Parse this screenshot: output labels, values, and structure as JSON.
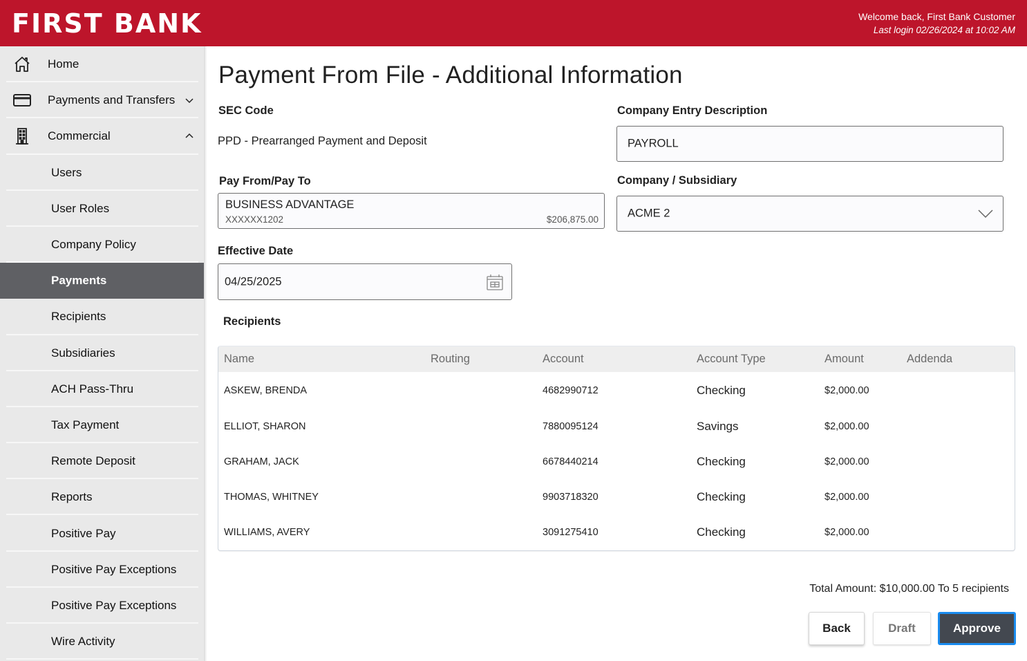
{
  "header": {
    "logo": "FIRST BANK",
    "welcome": "Welcome back, First Bank Customer",
    "last_login": "Last login 02/26/2024 at 10:02 AM",
    "brand_color": "#bd152b"
  },
  "sidebar": {
    "top_items": [
      {
        "label": "Home",
        "icon": "home-icon"
      },
      {
        "label": "Payments and Transfers",
        "icon": "card-icon",
        "chevron": "chevron-down-icon"
      },
      {
        "label": "Commercial",
        "icon": "building-icon",
        "chevron": "chevron-up-icon"
      }
    ],
    "sub_items": [
      {
        "label": "Users"
      },
      {
        "label": "User Roles"
      },
      {
        "label": "Company Policy"
      },
      {
        "label": "Payments",
        "active": true
      },
      {
        "label": "Recipients"
      },
      {
        "label": "Subsidiaries"
      },
      {
        "label": "ACH Pass-Thru"
      },
      {
        "label": "Tax Payment"
      },
      {
        "label": "Remote Deposit"
      },
      {
        "label": "Reports"
      },
      {
        "label": "Positive Pay"
      },
      {
        "label": "Positive Pay Exceptions"
      },
      {
        "label": "Positive Pay Exceptions"
      },
      {
        "label": "Wire Activity"
      }
    ],
    "active_color": "#5f6064"
  },
  "main": {
    "title": "Payment From File - Additional Information",
    "sec_code": {
      "label": "SEC Code",
      "value": "PPD - Prearranged Payment and Deposit"
    },
    "company_entry": {
      "label": "Company Entry Description",
      "value": "PAYROLL"
    },
    "pay_from": {
      "label": "Pay From/Pay To",
      "account_name": "BUSINESS ADVANTAGE",
      "account_number": "XXXXXX1202",
      "balance": "$206,875.00"
    },
    "company_subsidiary": {
      "label": "Company / Subsidiary",
      "selected": "ACME 2"
    },
    "effective_date": {
      "label": "Effective Date",
      "value": "04/25/2025"
    },
    "recipients": {
      "label": "Recipients",
      "columns": [
        "Name",
        "Routing",
        "Account",
        "Account Type",
        "Amount",
        "Addenda"
      ],
      "rows": [
        {
          "name": "ASKEW, BRENDA",
          "routing": "",
          "account": "4682990712",
          "type": "Checking",
          "amount": "$2,000.00",
          "addenda": ""
        },
        {
          "name": "ELLIOT, SHARON",
          "routing": "",
          "account": "7880095124",
          "type": "Savings",
          "amount": "$2,000.00",
          "addenda": ""
        },
        {
          "name": "GRAHAM, JACK",
          "routing": "",
          "account": "6678440214",
          "type": "Checking",
          "amount": "$2,000.00",
          "addenda": ""
        },
        {
          "name": "THOMAS, WHITNEY",
          "routing": "",
          "account": "9903718320",
          "type": "Checking",
          "amount": "$2,000.00",
          "addenda": ""
        },
        {
          "name": "WILLIAMS, AVERY",
          "routing": "",
          "account": "3091275410",
          "type": "Checking",
          "amount": "$2,000.00",
          "addenda": ""
        }
      ]
    },
    "total": "Total Amount: $10,000.00 To 5 recipients",
    "buttons": {
      "back": "Back",
      "draft": "Draft",
      "approve": "Approve"
    },
    "approve_focus_color": "#1a8cf0"
  }
}
